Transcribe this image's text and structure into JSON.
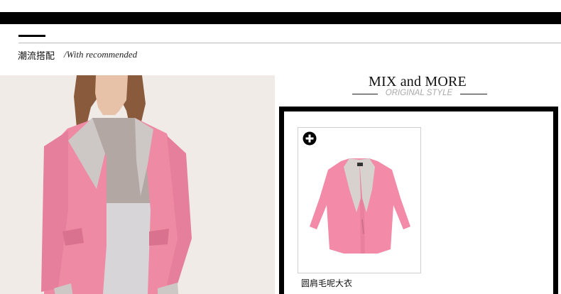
{
  "section": {
    "title": "潮流搭配",
    "subtitle": "/With recommended"
  },
  "mix": {
    "title": "MIX and MORE",
    "subtitle": "ORIGINAL STYLE"
  },
  "product": {
    "name": "圆肩毛呢大衣",
    "add_icon": "plus-circle-icon"
  },
  "colors": {
    "coat_pink": "#ef8aa6",
    "lapel_gray": "#c9c5c2",
    "accent": "#000000"
  }
}
